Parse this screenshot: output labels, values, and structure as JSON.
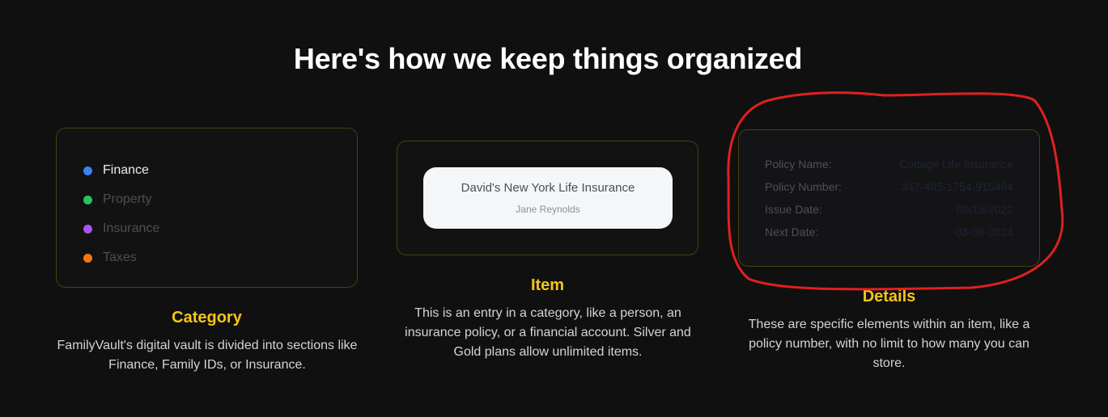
{
  "heading": "Here's how we keep things organized",
  "category": {
    "items": [
      {
        "label": "Finance",
        "color": "#3b82f6"
      },
      {
        "label": "Property",
        "color": "#22c55e"
      },
      {
        "label": "Insurance",
        "color": "#a855f7"
      },
      {
        "label": "Taxes",
        "color": "#f97316"
      }
    ],
    "title": "Category",
    "description": "FamilyVault's digital vault is divided into sections like Finance, Family IDs, or Insurance."
  },
  "item": {
    "card_title": "David's New York Life Insurance",
    "card_subtitle": "Jane Reynolds",
    "title": "Item",
    "description": "This is an entry in a category, like a person, an insurance policy, or a financial account. Silver and Gold plans allow unlimited items."
  },
  "details": {
    "rows": [
      {
        "label": "Policy Name:",
        "value": "Cottage Life Insurance"
      },
      {
        "label": "Policy Number:",
        "value": "347-495-1754-915464"
      },
      {
        "label": "Issue Date:",
        "value": "09/15/2022"
      },
      {
        "label": "Next Date:",
        "value": "03-09-2024"
      }
    ],
    "title": "Details",
    "description": "These are specific elements within an item, like a policy number, with no limit to how many you can store."
  },
  "colors": {
    "accent": "#f5c518",
    "background": "#101010",
    "annotation": "#e02020"
  }
}
